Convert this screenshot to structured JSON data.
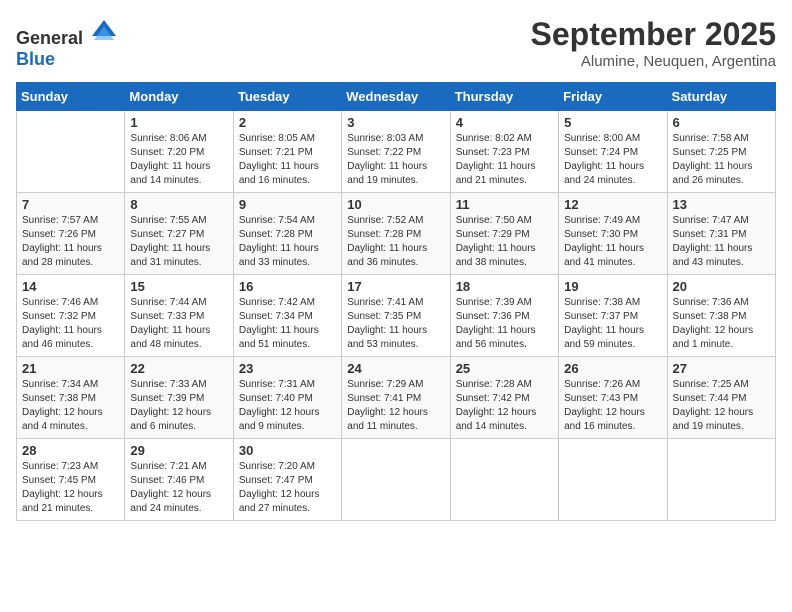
{
  "logo": {
    "general": "General",
    "blue": "Blue"
  },
  "title": "September 2025",
  "location": "Alumine, Neuquen, Argentina",
  "days_of_week": [
    "Sunday",
    "Monday",
    "Tuesday",
    "Wednesday",
    "Thursday",
    "Friday",
    "Saturday"
  ],
  "weeks": [
    [
      {
        "day": "",
        "content": ""
      },
      {
        "day": "1",
        "content": "Sunrise: 8:06 AM\nSunset: 7:20 PM\nDaylight: 11 hours\nand 14 minutes."
      },
      {
        "day": "2",
        "content": "Sunrise: 8:05 AM\nSunset: 7:21 PM\nDaylight: 11 hours\nand 16 minutes."
      },
      {
        "day": "3",
        "content": "Sunrise: 8:03 AM\nSunset: 7:22 PM\nDaylight: 11 hours\nand 19 minutes."
      },
      {
        "day": "4",
        "content": "Sunrise: 8:02 AM\nSunset: 7:23 PM\nDaylight: 11 hours\nand 21 minutes."
      },
      {
        "day": "5",
        "content": "Sunrise: 8:00 AM\nSunset: 7:24 PM\nDaylight: 11 hours\nand 24 minutes."
      },
      {
        "day": "6",
        "content": "Sunrise: 7:58 AM\nSunset: 7:25 PM\nDaylight: 11 hours\nand 26 minutes."
      }
    ],
    [
      {
        "day": "7",
        "content": "Sunrise: 7:57 AM\nSunset: 7:26 PM\nDaylight: 11 hours\nand 28 minutes."
      },
      {
        "day": "8",
        "content": "Sunrise: 7:55 AM\nSunset: 7:27 PM\nDaylight: 11 hours\nand 31 minutes."
      },
      {
        "day": "9",
        "content": "Sunrise: 7:54 AM\nSunset: 7:28 PM\nDaylight: 11 hours\nand 33 minutes."
      },
      {
        "day": "10",
        "content": "Sunrise: 7:52 AM\nSunset: 7:28 PM\nDaylight: 11 hours\nand 36 minutes."
      },
      {
        "day": "11",
        "content": "Sunrise: 7:50 AM\nSunset: 7:29 PM\nDaylight: 11 hours\nand 38 minutes."
      },
      {
        "day": "12",
        "content": "Sunrise: 7:49 AM\nSunset: 7:30 PM\nDaylight: 11 hours\nand 41 minutes."
      },
      {
        "day": "13",
        "content": "Sunrise: 7:47 AM\nSunset: 7:31 PM\nDaylight: 11 hours\nand 43 minutes."
      }
    ],
    [
      {
        "day": "14",
        "content": "Sunrise: 7:46 AM\nSunset: 7:32 PM\nDaylight: 11 hours\nand 46 minutes."
      },
      {
        "day": "15",
        "content": "Sunrise: 7:44 AM\nSunset: 7:33 PM\nDaylight: 11 hours\nand 48 minutes."
      },
      {
        "day": "16",
        "content": "Sunrise: 7:42 AM\nSunset: 7:34 PM\nDaylight: 11 hours\nand 51 minutes."
      },
      {
        "day": "17",
        "content": "Sunrise: 7:41 AM\nSunset: 7:35 PM\nDaylight: 11 hours\nand 53 minutes."
      },
      {
        "day": "18",
        "content": "Sunrise: 7:39 AM\nSunset: 7:36 PM\nDaylight: 11 hours\nand 56 minutes."
      },
      {
        "day": "19",
        "content": "Sunrise: 7:38 AM\nSunset: 7:37 PM\nDaylight: 11 hours\nand 59 minutes."
      },
      {
        "day": "20",
        "content": "Sunrise: 7:36 AM\nSunset: 7:38 PM\nDaylight: 12 hours\nand 1 minute."
      }
    ],
    [
      {
        "day": "21",
        "content": "Sunrise: 7:34 AM\nSunset: 7:38 PM\nDaylight: 12 hours\nand 4 minutes."
      },
      {
        "day": "22",
        "content": "Sunrise: 7:33 AM\nSunset: 7:39 PM\nDaylight: 12 hours\nand 6 minutes."
      },
      {
        "day": "23",
        "content": "Sunrise: 7:31 AM\nSunset: 7:40 PM\nDaylight: 12 hours\nand 9 minutes."
      },
      {
        "day": "24",
        "content": "Sunrise: 7:29 AM\nSunset: 7:41 PM\nDaylight: 12 hours\nand 11 minutes."
      },
      {
        "day": "25",
        "content": "Sunrise: 7:28 AM\nSunset: 7:42 PM\nDaylight: 12 hours\nand 14 minutes."
      },
      {
        "day": "26",
        "content": "Sunrise: 7:26 AM\nSunset: 7:43 PM\nDaylight: 12 hours\nand 16 minutes."
      },
      {
        "day": "27",
        "content": "Sunrise: 7:25 AM\nSunset: 7:44 PM\nDaylight: 12 hours\nand 19 minutes."
      }
    ],
    [
      {
        "day": "28",
        "content": "Sunrise: 7:23 AM\nSunset: 7:45 PM\nDaylight: 12 hours\nand 21 minutes."
      },
      {
        "day": "29",
        "content": "Sunrise: 7:21 AM\nSunset: 7:46 PM\nDaylight: 12 hours\nand 24 minutes."
      },
      {
        "day": "30",
        "content": "Sunrise: 7:20 AM\nSunset: 7:47 PM\nDaylight: 12 hours\nand 27 minutes."
      },
      {
        "day": "",
        "content": ""
      },
      {
        "day": "",
        "content": ""
      },
      {
        "day": "",
        "content": ""
      },
      {
        "day": "",
        "content": ""
      }
    ]
  ]
}
